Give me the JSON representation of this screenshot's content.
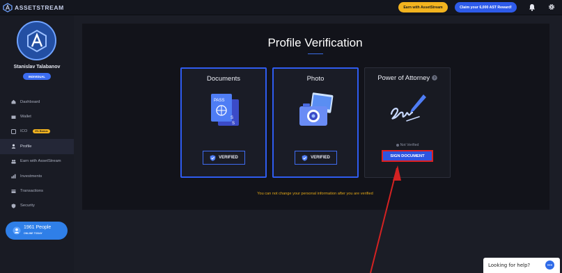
{
  "app": {
    "logo_text": "ASSETSTREAM"
  },
  "header": {
    "earn_label": "Earn with AssetStream",
    "claim_label": "Claim your 6,000 AST Reward!",
    "icons": [
      "bell-icon",
      "gear-icon"
    ]
  },
  "sidebar": {
    "user_name": "Stanislav Talabanov",
    "badge": "INDIVIDUAL",
    "items": [
      {
        "label": "Dashboard",
        "icon": "dashboard-icon"
      },
      {
        "label": "Wallet",
        "icon": "wallet-icon"
      },
      {
        "label": "ICO",
        "icon": "ico-icon",
        "badge": "0% Bonus"
      },
      {
        "label": "Profile",
        "icon": "user-icon",
        "active": true
      },
      {
        "label": "Earn with AssetStream",
        "icon": "people-icon"
      },
      {
        "label": "Investments",
        "icon": "investments-icon"
      },
      {
        "label": "Transactions",
        "icon": "transactions-icon"
      },
      {
        "label": "Security",
        "icon": "shield-icon"
      }
    ],
    "online": {
      "count": "1961 People",
      "label": "ONLINE TODAY"
    }
  },
  "main": {
    "title": "Profile Verification",
    "cards": [
      {
        "title": "Documents",
        "status": "VERIFIED",
        "icon": "passport-icon"
      },
      {
        "title": "Photo",
        "status": "VERIFIED",
        "icon": "camera-icon"
      },
      {
        "title": "Power of Attorney",
        "status_text": "Not Verified",
        "button": "SIGN DOCUMENT",
        "icon": "signature-icon",
        "help_icon": "question-icon"
      }
    ],
    "info": "You can not change your personal information after you are verified"
  },
  "help_widget": {
    "label": "Looking for help?"
  },
  "colors": {
    "accent": "#2f5cf0",
    "gold": "#f2b31f",
    "highlight": "#e02020"
  }
}
